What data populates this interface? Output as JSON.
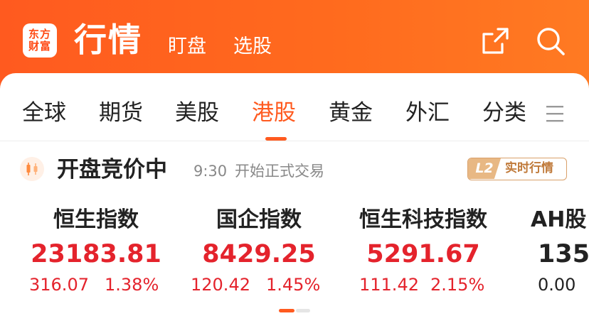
{
  "header": {
    "logo_line1": "东方",
    "logo_line2": "财富",
    "title": "行情",
    "links": [
      "盯盘",
      "选股"
    ],
    "icons": [
      "share-icon",
      "search-icon"
    ],
    "background_color": "#ff5a1f"
  },
  "tabs": {
    "items": [
      "全球",
      "期货",
      "美股",
      "港股",
      "黄金",
      "外汇",
      "分类"
    ],
    "active": "港股",
    "accent_color": "#ff5a1f",
    "menu_icon": "menu-lines-icon"
  },
  "status": {
    "title": "开盘竞价中",
    "time": "9:30",
    "note": "开始正式交易",
    "badge_l2": "L2",
    "badge_text": "实时行情"
  },
  "indices": [
    {
      "name": "恒生指数",
      "price": "23183.81",
      "change": "316.07",
      "percent": "1.38%"
    },
    {
      "name": "国企指数",
      "price": "8429.25",
      "change": "120.42",
      "percent": "1.45%"
    },
    {
      "name": "恒生科技指数",
      "price": "5291.67",
      "change": "111.42",
      "percent": "2.15%"
    },
    {
      "name": "AH股",
      "price": "135",
      "change": "0.00",
      "percent": ""
    }
  ],
  "colors": {
    "up": "#e4232c"
  }
}
